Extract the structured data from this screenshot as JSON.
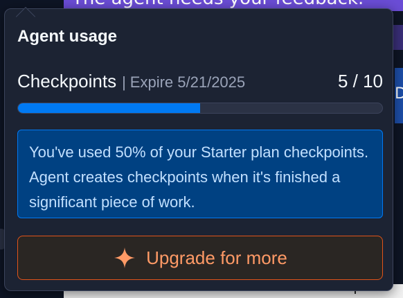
{
  "background": {
    "banner_text": "The agent needs your feedback.",
    "edge_glyph": "D"
  },
  "popover": {
    "title": "Agent usage",
    "usage": {
      "label": "Checkpoints",
      "separator": "|",
      "expiry": "Expire 5/21/2025",
      "count": "5 / 10",
      "progress_fraction": 0.5
    },
    "info": {
      "text": "You've used 50% of your Starter plan checkpoints. Agent creates checkpoints when it's finished a significant piece of work."
    },
    "upgrade_button": {
      "icon": "sparkle-icon",
      "label": "Upgrade for more"
    }
  },
  "colors": {
    "popover_bg": "#1c2333",
    "progress_fill": "#0079f2",
    "info_bg": "#004182",
    "info_border": "#0079f2",
    "upgrade_border": "#e2541a",
    "upgrade_text": "#ff9a66"
  }
}
